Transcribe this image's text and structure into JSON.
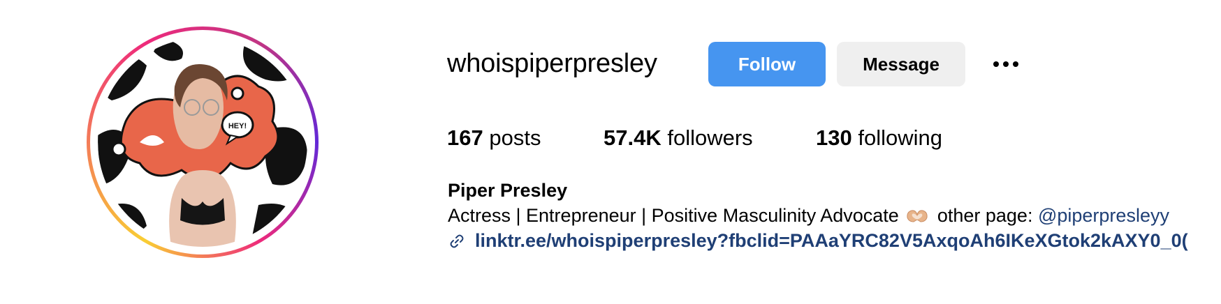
{
  "profile": {
    "username": "whoispiperpresley",
    "full_name": "Piper Presley",
    "bio_text": "Actress | Entrepreneur | Positive Masculinity Advocate",
    "bio_emoji": "heart-hands-emoji",
    "bio_other_label": "other page:",
    "bio_mention": "@piperpresleyy",
    "link": "linktr.ee/whoispiperpresley?fbclid=PAAaYRC82V5AxqoAh6IKeXGtok2kAXY0_0("
  },
  "actions": {
    "follow_label": "Follow",
    "message_label": "Message",
    "more_icon": "more-options-icon"
  },
  "stats": {
    "posts_count": "167",
    "posts_label": "posts",
    "followers_count": "57.4K",
    "followers_label": "followers",
    "following_count": "130",
    "following_label": "following"
  },
  "avatar": {
    "speech_bubble_text": "HEY!",
    "ring_colors": [
      "#f9ce34",
      "#ee2a7b",
      "#6228d7"
    ]
  },
  "colors": {
    "follow_button": "#4695f0",
    "message_button": "#efefef",
    "link": "#1f3f75"
  }
}
